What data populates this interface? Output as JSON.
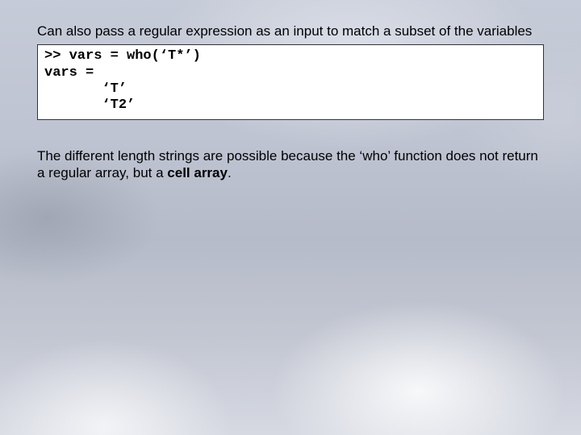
{
  "intro": "Can also pass a regular expression as an input to match a subset of the variables",
  "code": {
    "line1": ">> vars = who(‘T*’)",
    "line2": "vars =",
    "line3": "       ‘T’",
    "line4": "       ‘T2’"
  },
  "explain": {
    "pre": "The different length strings are possible because the ‘who’ function does not return a regular array, but a ",
    "bold": "cell array",
    "post": "."
  }
}
